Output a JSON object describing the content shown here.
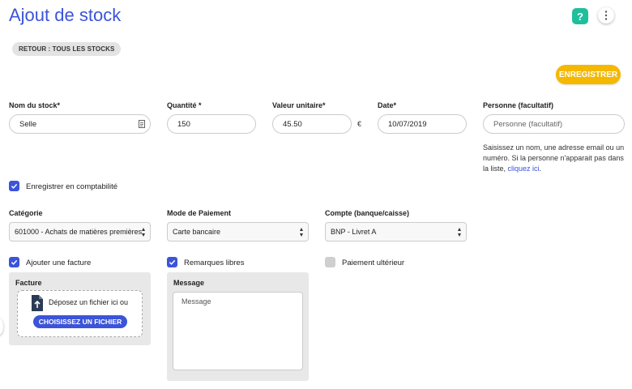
{
  "header": {
    "title": "Ajout de stock",
    "help_label": "?",
    "more_icon": "more-vertical-icon"
  },
  "back_chip": {
    "label": "RETOUR : TOUS LES STOCKS"
  },
  "save_button": {
    "label": "ENREGISTRER",
    "color": "#f5b800"
  },
  "accent_color": "#3b54d9",
  "fields": {
    "stock_name": {
      "label": "Nom du stock*",
      "value": "Selle",
      "icon": "document-icon"
    },
    "quantity": {
      "label": "Quantité *",
      "value": "150"
    },
    "unit_value": {
      "label": "Valeur unitaire*",
      "value": "45.50",
      "currency": "€"
    },
    "date": {
      "label": "Date*",
      "value": "10/07/2019"
    },
    "person": {
      "label": "Personne (facultatif)",
      "placeholder": "Personne (facultatif)"
    }
  },
  "person_help": {
    "text": "Saisissez un nom, une adresse email ou un numéro. Si la personne n'apparait pas dans la liste,",
    "link": "cliquez ici",
    "suffix": "."
  },
  "accounting": {
    "label": "Enregistrer en comptabilité",
    "checked": true
  },
  "selects": {
    "category": {
      "label": "Catégorie",
      "value": "601000 - Achats de matières premières"
    },
    "payment_mode": {
      "label": "Mode de Paiement",
      "value": "Carte bancaire"
    },
    "account": {
      "label": "Compte (banque/caisse)",
      "value": "BNP - Livret A"
    }
  },
  "options": {
    "invoice": {
      "label": "Ajouter une facture",
      "checked": true
    },
    "remarks": {
      "label": "Remarques libres",
      "checked": true
    },
    "later_payment": {
      "label": "Paiement ultérieur",
      "checked": false
    }
  },
  "invoice_panel": {
    "title": "Facture",
    "drop_text": "Déposez un fichier ici ou",
    "button_label": "CHOISISSEZ UN FICHIER",
    "icon": "file-upload-icon"
  },
  "message_panel": {
    "title": "Message",
    "placeholder": "Message"
  }
}
